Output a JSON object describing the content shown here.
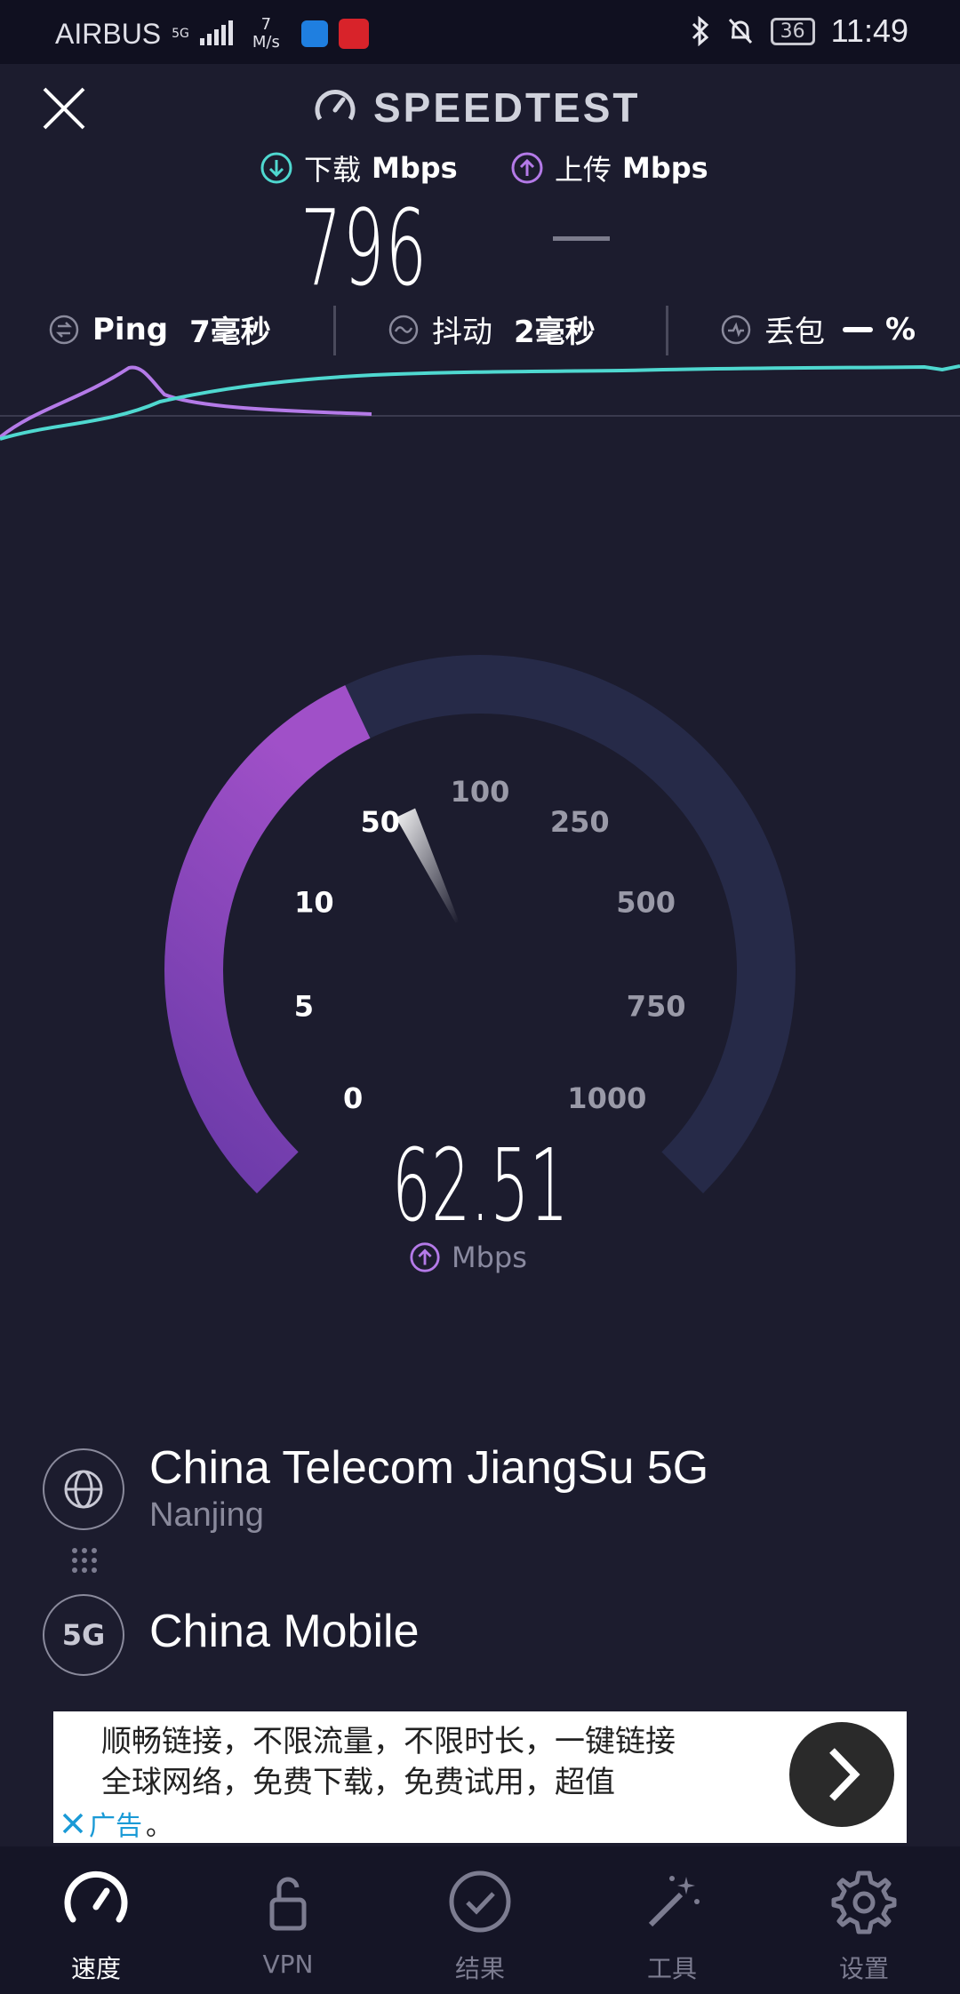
{
  "status_bar": {
    "carrier": "AIRBUS",
    "network_tag": "5G",
    "speed_value": "7",
    "speed_unit": "M/s",
    "battery": "36",
    "time": "11:49"
  },
  "header": {
    "brand": "SPEEDTEST"
  },
  "metrics": {
    "download_label": "下载",
    "download_unit": "Mbps",
    "download_value": "796",
    "upload_label": "上传",
    "upload_unit": "Mbps"
  },
  "stats": {
    "ping_label": "Ping",
    "ping_value": "7毫秒",
    "jitter_label": "抖动",
    "jitter_value": "2毫秒",
    "loss_label": "丢包",
    "loss_value": "%"
  },
  "gauge": {
    "ticks": [
      "0",
      "5",
      "10",
      "50",
      "100",
      "250",
      "500",
      "750",
      "1000"
    ],
    "current_value": "62.51",
    "unit": "Mbps",
    "current_mbps": 62.51
  },
  "server": {
    "provider": "China Telecom JiangSu 5G",
    "city": "Nanjing",
    "client_badge": "5G",
    "client_provider": "China Mobile"
  },
  "ad": {
    "line1": "顺畅链接，不限流量，不限时长，一键链接",
    "line2": "全球网络，免费下载，免费试用，超值",
    "tag": "广告",
    "tail": "。"
  },
  "tabs": [
    {
      "label": "速度",
      "icon": "speed-icon",
      "active": true
    },
    {
      "label": "VPN",
      "icon": "lock-icon",
      "active": false
    },
    {
      "label": "结果",
      "icon": "check-circle-icon",
      "active": false
    },
    {
      "label": "工具",
      "icon": "wand-icon",
      "active": false
    },
    {
      "label": "设置",
      "icon": "gear-icon",
      "active": false
    }
  ],
  "colors": {
    "background": "#1c1c2e",
    "download_accent": "#4fd8d0",
    "upload_accent": "#b47ae8",
    "gauge_track": "#262a48"
  }
}
